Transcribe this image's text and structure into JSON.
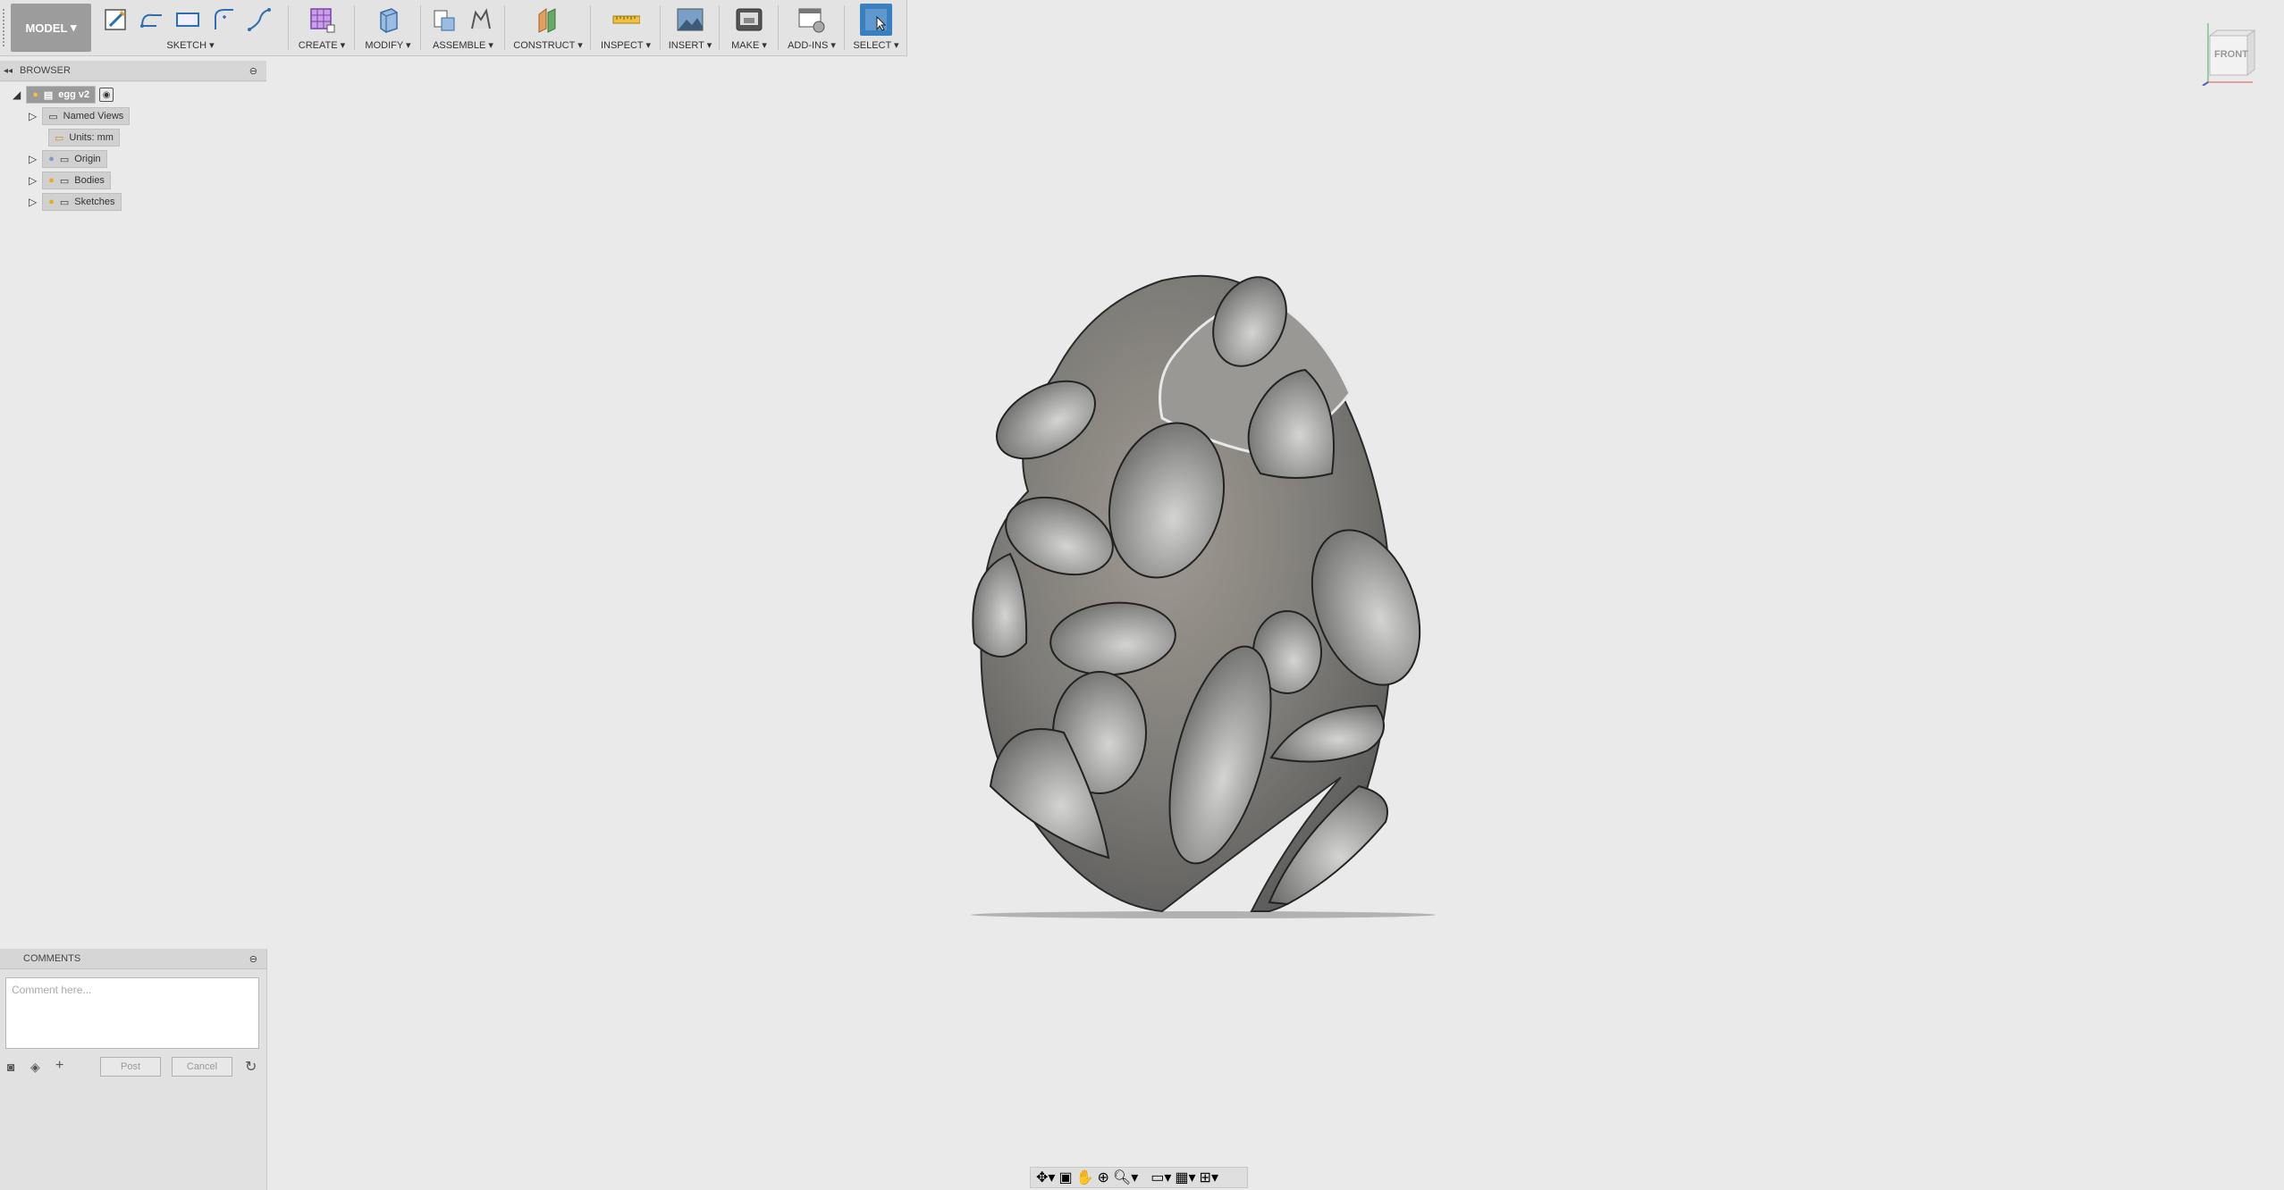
{
  "toolbar": {
    "workspace_label": "MODEL",
    "groups": [
      {
        "label": "SKETCH"
      },
      {
        "label": "CREATE"
      },
      {
        "label": "MODIFY"
      },
      {
        "label": "ASSEMBLE"
      },
      {
        "label": "CONSTRUCT"
      },
      {
        "label": "INSPECT"
      },
      {
        "label": "INSERT"
      },
      {
        "label": "MAKE"
      },
      {
        "label": "ADD-INS"
      },
      {
        "label": "SELECT"
      }
    ]
  },
  "browser": {
    "title": "BROWSER",
    "root": "egg v2",
    "items": [
      "Named Views",
      "Units: mm",
      "Origin",
      "Bodies",
      "Sketches"
    ]
  },
  "comments": {
    "title": "COMMENTS",
    "placeholder": "Comment here...",
    "post_label": "Post",
    "cancel_label": "Cancel"
  },
  "viewcube": {
    "face_label": "FRONT"
  },
  "colors": {
    "accent": "#3a7fbf",
    "model": "#8a8a86",
    "background": "#eaeaea"
  },
  "icons": [
    "create-sketch-icon",
    "line-icon",
    "rectangle-icon",
    "arc-icon",
    "spline-icon",
    "form-icon",
    "press-pull-icon",
    "new-component-icon",
    "joint-icon",
    "offset-plane-icon",
    "measure-icon",
    "insert-image-icon",
    "3d-print-icon",
    "scripts-icon",
    "select-icon"
  ]
}
